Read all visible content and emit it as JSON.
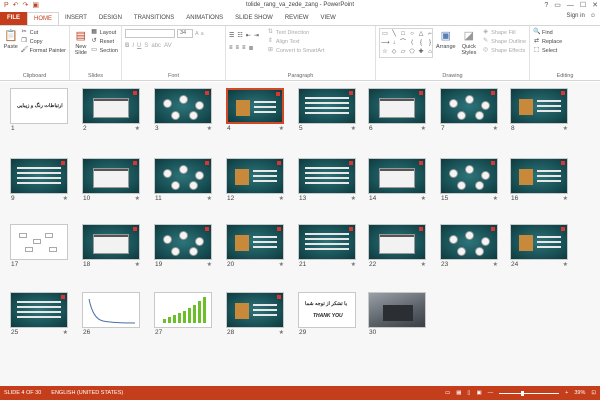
{
  "window": {
    "title": "tolide_rang_va_zede_zang - PowerPoint",
    "controls": [
      "?",
      "▭",
      "—",
      "☐",
      "✕"
    ]
  },
  "qat": [
    "P",
    "↶",
    "↷",
    "▣"
  ],
  "tabs": [
    {
      "label": "FILE",
      "key": "file"
    },
    {
      "label": "HOME",
      "key": "home"
    },
    {
      "label": "INSERT",
      "key": "insert"
    },
    {
      "label": "DESIGN",
      "key": "design"
    },
    {
      "label": "TRANSITIONS",
      "key": "transitions"
    },
    {
      "label": "ANIMATIONS",
      "key": "animations"
    },
    {
      "label": "SLIDE SHOW",
      "key": "slideshow"
    },
    {
      "label": "REVIEW",
      "key": "review"
    },
    {
      "label": "VIEW",
      "key": "view"
    }
  ],
  "active_tab": "HOME",
  "signin": "Sign in",
  "ribbon": {
    "clipboard": {
      "paste": "Paste",
      "cut": "Cut",
      "copy": "Copy",
      "format_painter": "Format Painter",
      "label": "Clipboard"
    },
    "slides": {
      "new_slide": "New Slide",
      "layout": "Layout",
      "reset": "Reset",
      "section": "Section",
      "label": "Slides"
    },
    "font": {
      "size": "34",
      "label": "Font",
      "buttons": [
        "B",
        "I",
        "U",
        "S",
        "abc",
        "AV"
      ]
    },
    "paragraph": {
      "text_direction": "Text Direction",
      "align_text": "Align Text",
      "smartart": "Convert to SmartArt",
      "label": "Paragraph"
    },
    "drawing": {
      "arrange": "Arrange",
      "quick_styles": "Quick Styles",
      "shape_fill": "Shape Fill",
      "shape_outline": "Shape Outline",
      "shape_effects": "Shape Effects",
      "label": "Drawing",
      "shapes": [
        "▭",
        "╲",
        "□",
        "○",
        "△",
        "⌐",
        "⟶",
        "↓",
        "⌒",
        "⟨",
        "{",
        "}",
        "☆",
        "◇",
        "▱",
        "⬠",
        "✚",
        "⌂"
      ]
    },
    "editing": {
      "find": "Find",
      "replace": "Replace",
      "select": "Select",
      "label": "Editing"
    }
  },
  "slides": [
    {
      "n": "1",
      "style": "white",
      "caption": "ارتباطات رنگ و زیبایی",
      "star": ""
    },
    {
      "n": "2",
      "style": "teal",
      "star": "★"
    },
    {
      "n": "3",
      "style": "teal",
      "star": "★"
    },
    {
      "n": "4",
      "style": "teal",
      "selected": true,
      "star": "★"
    },
    {
      "n": "5",
      "style": "teal",
      "star": "★"
    },
    {
      "n": "6",
      "style": "teal",
      "star": "★"
    },
    {
      "n": "7",
      "style": "teal",
      "star": "★"
    },
    {
      "n": "8",
      "style": "teal",
      "star": "★"
    },
    {
      "n": "9",
      "style": "teal",
      "star": "★"
    },
    {
      "n": "10",
      "style": "teal",
      "star": "★"
    },
    {
      "n": "11",
      "style": "teal",
      "star": "★"
    },
    {
      "n": "12",
      "style": "teal",
      "star": "★"
    },
    {
      "n": "13",
      "style": "teal",
      "star": "★"
    },
    {
      "n": "14",
      "style": "teal",
      "star": "★"
    },
    {
      "n": "15",
      "style": "teal",
      "star": "★"
    },
    {
      "n": "16",
      "style": "teal",
      "star": "★"
    },
    {
      "n": "17",
      "style": "white",
      "star": ""
    },
    {
      "n": "18",
      "style": "teal",
      "star": "★"
    },
    {
      "n": "19",
      "style": "teal",
      "star": "★"
    },
    {
      "n": "20",
      "style": "teal",
      "star": "★"
    },
    {
      "n": "21",
      "style": "teal",
      "star": "★"
    },
    {
      "n": "22",
      "style": "teal",
      "star": "★"
    },
    {
      "n": "23",
      "style": "teal",
      "star": "★"
    },
    {
      "n": "24",
      "style": "teal",
      "star": "★"
    },
    {
      "n": "25",
      "style": "teal",
      "star": "★"
    },
    {
      "n": "26",
      "style": "white",
      "star": ""
    },
    {
      "n": "27",
      "style": "white",
      "star": ""
    },
    {
      "n": "28",
      "style": "teal",
      "star": "★"
    },
    {
      "n": "29",
      "style": "white",
      "caption": "با تشکر از توجه شما",
      "caption2": "THANK YOU",
      "star": ""
    },
    {
      "n": "30",
      "style": "photo",
      "star": ""
    }
  ],
  "status": {
    "slide": "SLIDE 4 OF 30",
    "language": "ENGLISH (UNITED STATES)",
    "zoom": "39%",
    "zoom_level": 0.39
  },
  "colors": {
    "accent": "#c43e1c",
    "slide_bg": "#164d52"
  }
}
